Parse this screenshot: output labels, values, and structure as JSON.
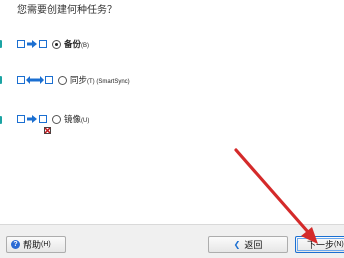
{
  "prompt": "您需要创建何种任务？",
  "options": [
    {
      "label": "备份",
      "key": "(B)",
      "checked": true
    },
    {
      "label": "同步",
      "key": "(T) (SmartSync)",
      "checked": false
    },
    {
      "label": "镜像",
      "key": "(U)",
      "checked": false
    }
  ],
  "footer": {
    "help": {
      "label": "帮助",
      "key": "(H)"
    },
    "back": {
      "label": "返回"
    },
    "next": {
      "label": "下一步",
      "key": "(N)"
    }
  },
  "colors": {
    "accent": "#1b6fd1",
    "edge_marker": "#1aa3a3",
    "annotation_arrow": "#d42a2a"
  },
  "icons": {
    "backup": "square-arrow-square-icon",
    "sync": "square-double-arrow-square-icon",
    "mirror": "square-arrow-square-icon",
    "mirror_delete": "red-x-icon",
    "help": "question-circle-icon",
    "back": "chevron-left-icon",
    "pointer": "red-arrow-annotation"
  }
}
